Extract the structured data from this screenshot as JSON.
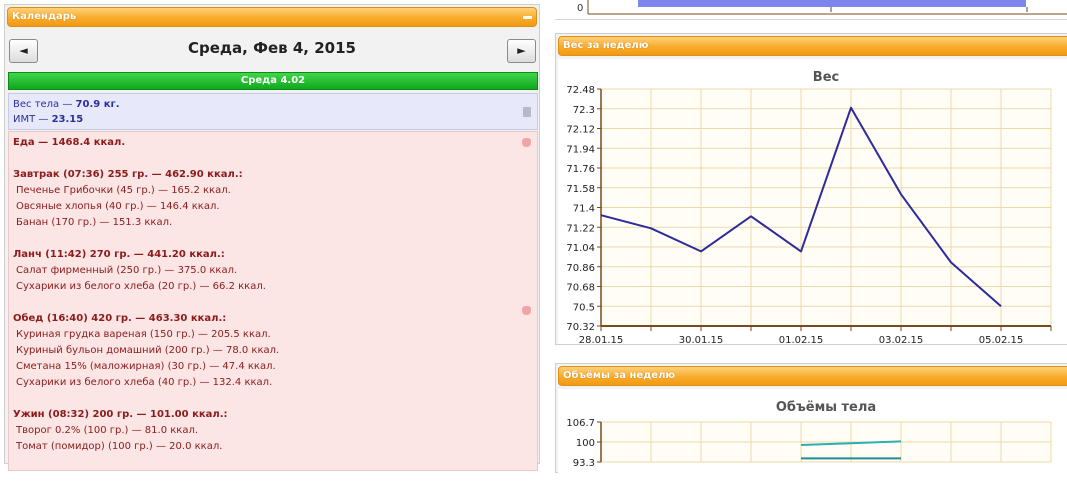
{
  "calendar": {
    "title": "Календарь",
    "date": "Среда, Фев 4, 2015",
    "prev_label": "◄",
    "next_label": "►",
    "day_header": "Среда 4.02",
    "weight_label": "Вес тела — ",
    "weight_value": "70.9 кг.",
    "bmi_label": "ИМТ — ",
    "bmi_value": "23.15",
    "food_total": "Еда — 1468.4 ккал.",
    "meals": [
      {
        "title": "Завтрак (07:36) 255 гр. — 462.90 ккал.:",
        "items": [
          "Печенье Грибочки (45 гр.) — 165.2 ккал.",
          "Овсяные хлопья (40 гр.) — 146.4 ккал.",
          "Банан (170 гр.) — 151.3 ккал."
        ]
      },
      {
        "title": "Ланч (11:42) 270 гр. — 441.20 ккал.:",
        "items": [
          "Салат фирменный (250 гр.) — 375.0 ккал.",
          "Сухарики из белого хлеба (20 гр.) — 66.2 ккал."
        ]
      },
      {
        "title": "Обед (16:40) 420 гр. — 463.30 ккал.:",
        "items": [
          "Куриная грудка вареная (150 гр.) — 205.5 ккал.",
          "Куриный бульон домашний (200 гр.) — 78.0 ккал.",
          "Сметана 15% (маложирная) (30 гр.) — 47.4 ккал.",
          "Сухарики из белого хлеба (40 гр.) — 132.4 ккал."
        ]
      },
      {
        "title": "Ужин (08:32) 200 гр. — 101.00 ккал.:",
        "items": [
          "Творог 0.2% (100 гр.) — 81.0 ккал.",
          "Томат (помидор) (100 гр.) — 20.0 ккал."
        ]
      }
    ]
  },
  "top_chart": {
    "tick_label": "0"
  },
  "weight_panel": {
    "title": "Вес за неделю"
  },
  "volume_panel": {
    "title": "Объёмы за неделю"
  },
  "chart_data": [
    {
      "type": "line",
      "title": "Вес",
      "x": [
        "28.01.15",
        "29.01.15",
        "30.01.15",
        "31.01.15",
        "01.02.15",
        "02.02.15",
        "03.02.15",
        "04.02.15",
        "05.02.15"
      ],
      "x_tick_labels": [
        "28.01.15",
        "30.01.15",
        "01.02.15",
        "03.02.15",
        "05.02.15"
      ],
      "y_tick_labels": [
        "72.48",
        "72.3",
        "72.12",
        "71.94",
        "71.76",
        "71.58",
        "71.4",
        "71.22",
        "71.04",
        "70.86",
        "70.68",
        "70.5",
        "70.32"
      ],
      "ylim": [
        70.32,
        72.48
      ],
      "series": [
        {
          "values": [
            71.33,
            71.21,
            71.0,
            71.32,
            71.0,
            72.31,
            71.52,
            70.9,
            70.5
          ],
          "color": "#2b2b9c"
        }
      ],
      "grid": true
    },
    {
      "type": "line",
      "title": "Объёмы тела",
      "y_tick_labels": [
        "106.7",
        "100",
        "93.3"
      ],
      "ylim": [
        93.3,
        106.7
      ],
      "series": [
        {
          "values": [
            null,
            null,
            null,
            null,
            99.0,
            99.6,
            100.2
          ],
          "color": "#2ab0b0"
        },
        {
          "values": [
            null,
            null,
            null,
            null,
            94.5,
            94.5,
            94.5
          ],
          "color": "#1b8e8e"
        }
      ],
      "grid": true
    }
  ]
}
